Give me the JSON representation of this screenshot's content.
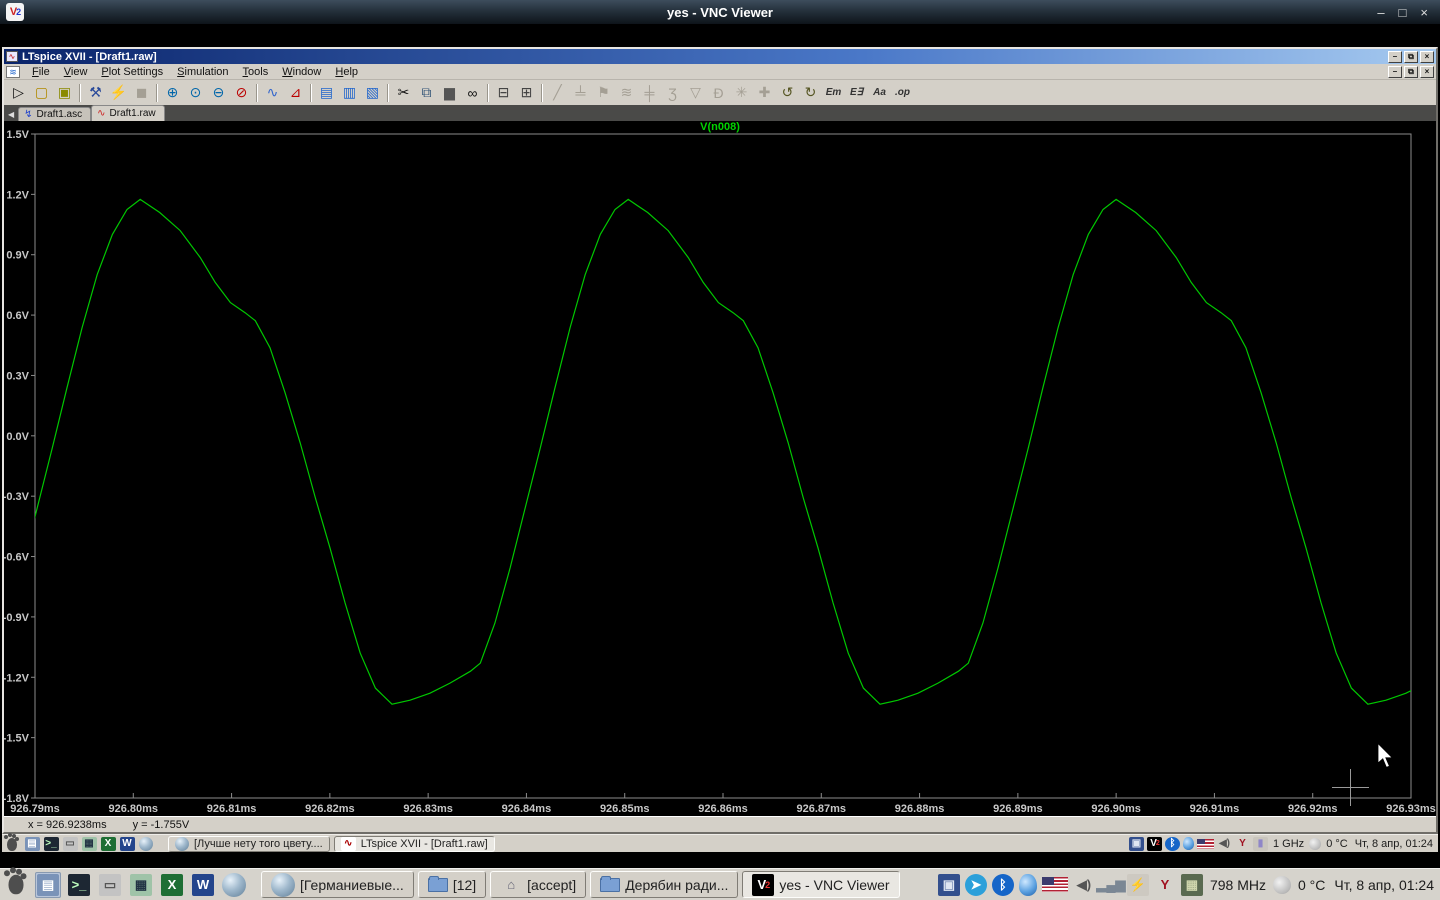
{
  "vnc_titlebar": {
    "logo_text": "V2",
    "title": "yes - VNC Viewer",
    "controls": [
      {
        "name": "vnc-minimize-button",
        "glyph": "–"
      },
      {
        "name": "vnc-maximize-button",
        "glyph": "□"
      },
      {
        "name": "vnc-close-button",
        "glyph": "×"
      }
    ]
  },
  "ltspice": {
    "title": "LTspice XVII - [Draft1.raw]",
    "app_icon_glyph": "∿",
    "menu_icon_glyph": "≋",
    "window_controls": [
      {
        "name": "minimize-button",
        "glyph": "–"
      },
      {
        "name": "restore-button",
        "glyph": "⧉"
      },
      {
        "name": "close-button",
        "glyph": "×"
      }
    ],
    "child_window_controls": [
      {
        "name": "child-minimize-button",
        "glyph": "–"
      },
      {
        "name": "child-restore-button",
        "glyph": "⧉"
      },
      {
        "name": "child-close-button",
        "glyph": "×"
      }
    ],
    "menus": [
      "File",
      "View",
      "Plot Settings",
      "Simulation",
      "Tools",
      "Window",
      "Help"
    ],
    "toolbar": [
      {
        "name": "new-schematic-button",
        "icon": "new-schematic-icon",
        "glyph": "▷",
        "color": "#111"
      },
      {
        "name": "open-button",
        "icon": "open-folder-icon",
        "glyph": "▢",
        "color": "#b08a00"
      },
      {
        "name": "save-button",
        "icon": "save-floppy-icon",
        "glyph": "▣",
        "color": "#8a8a00"
      },
      {
        "sep": true
      },
      {
        "name": "control-panel-button",
        "icon": "hammer-icon",
        "glyph": "⚒",
        "color": "#2a4a9a"
      },
      {
        "name": "run-button",
        "icon": "run-man-icon",
        "glyph": "⚡",
        "color": "#333"
      },
      {
        "name": "halt-button",
        "icon": "halt-hand-icon",
        "glyph": "◼",
        "disabled": true
      },
      {
        "sep": true
      },
      {
        "name": "zoom-in-button",
        "icon": "zoom-in-icon",
        "glyph": "⊕",
        "color": "#06a"
      },
      {
        "name": "zoom-area-button",
        "icon": "magnifier-icon",
        "glyph": "⊙",
        "color": "#06a"
      },
      {
        "name": "zoom-out-button",
        "icon": "zoom-out-icon",
        "glyph": "⊖",
        "color": "#06a"
      },
      {
        "name": "zoom-full-extents-button",
        "icon": "zoom-full-icon",
        "glyph": "⊘",
        "color": "#b00"
      },
      {
        "sep": true
      },
      {
        "name": "autorange-y-button",
        "icon": "waveform-icon",
        "glyph": "∿",
        "color": "#36c"
      },
      {
        "name": "plot-settings-button",
        "icon": "axis-icon",
        "glyph": "⊿",
        "color": "#b00"
      },
      {
        "sep": true
      },
      {
        "name": "tile-horizontal-button",
        "icon": "tile-horizontal-icon",
        "glyph": "▤",
        "color": "#26c"
      },
      {
        "name": "tile-vertical-button",
        "icon": "tile-vertical-icon",
        "glyph": "▥",
        "color": "#26c"
      },
      {
        "name": "cascade-button",
        "icon": "cascade-windows-icon",
        "glyph": "▧",
        "color": "#26c"
      },
      {
        "sep": true
      },
      {
        "name": "cut-button",
        "icon": "scissors-icon",
        "glyph": "✂",
        "color": "#111"
      },
      {
        "name": "copy-button",
        "icon": "copy-icon",
        "glyph": "⧉",
        "color": "#357"
      },
      {
        "name": "paste-button",
        "icon": "clipboard-icon",
        "glyph": "▆",
        "color": "#555"
      },
      {
        "name": "find-button",
        "icon": "binoculars-icon",
        "glyph": "∞",
        "color": "#111"
      },
      {
        "sep": true
      },
      {
        "name": "print-button",
        "icon": "printer-icon",
        "glyph": "⊟",
        "color": "#444"
      },
      {
        "name": "print-preview-button",
        "icon": "print-preview-icon",
        "glyph": "⊞",
        "color": "#444"
      },
      {
        "sep": true
      },
      {
        "name": "wire-button",
        "icon": "wire-icon",
        "glyph": "╱",
        "disabled": true
      },
      {
        "name": "ground-button",
        "icon": "ground-icon",
        "glyph": "╧",
        "disabled": true
      },
      {
        "name": "label-net-button",
        "icon": "net-label-icon",
        "glyph": "⚑",
        "disabled": true
      },
      {
        "name": "resistor-button",
        "icon": "resistor-icon",
        "glyph": "≋",
        "disabled": true
      },
      {
        "name": "capacitor-button",
        "icon": "capacitor-icon",
        "glyph": "╪",
        "disabled": true
      },
      {
        "name": "inductor-button",
        "icon": "inductor-icon",
        "glyph": "Ʒ",
        "disabled": true
      },
      {
        "name": "diode-button",
        "icon": "diode-icon",
        "glyph": "▽",
        "disabled": true
      },
      {
        "name": "gate-button",
        "icon": "d-gate-icon",
        "glyph": "Ð",
        "disabled": true
      },
      {
        "name": "component-button",
        "icon": "component-bug-icon",
        "glyph": "✳",
        "disabled": true
      },
      {
        "name": "drag-button",
        "icon": "hand-icon",
        "glyph": "✚",
        "disabled": true
      },
      {
        "name": "undo-button",
        "icon": "undo-icon",
        "glyph": "↺",
        "color": "#552"
      },
      {
        "name": "redo-button",
        "icon": "redo-icon",
        "glyph": "↻",
        "color": "#552"
      },
      {
        "name": "mirror-button",
        "icon": "mirror-icon",
        "glyph": "Em",
        "text": true,
        "color": "#333"
      },
      {
        "name": "rotate-button",
        "icon": "rotate-icon",
        "glyph": "E∃",
        "text": true,
        "color": "#333"
      },
      {
        "name": "text-button",
        "icon": "text-icon",
        "glyph": "Aa",
        "text": true,
        "color": "#333"
      },
      {
        "name": "spice-directive-button",
        "icon": "spice-directive-icon",
        "glyph": ".op",
        "text": true,
        "color": "#333"
      }
    ],
    "tabbar": {
      "scroll_glyph": "◀",
      "tabs": [
        {
          "label": "Draft1.asc",
          "icon": "schematic-tab-icon",
          "glyph": "↯",
          "glyph_color": "#2244cc",
          "active": false
        },
        {
          "label": "Draft1.raw",
          "icon": "waveform-tab-icon",
          "glyph": "∿",
          "glyph_color": "#cc2222",
          "active": true
        }
      ]
    },
    "statusbar": {
      "x_readout": "x = 926.9238ms",
      "y_readout": "y = -1.755V"
    }
  },
  "chart_data": {
    "type": "line",
    "title": "V(n008)",
    "trace_color": "#00c800",
    "title_color": "#00d400",
    "axis_color": "#8c8c8c",
    "label_color": "#c8c8c8",
    "background": "#000000",
    "x_unit": "ms",
    "y_unit": "V",
    "xlim": [
      926.79,
      926.93
    ],
    "ylim": [
      -1.8,
      1.5
    ],
    "grid": false,
    "xticks": [
      {
        "value": 926.79,
        "label": "926.79ms"
      },
      {
        "value": 926.8,
        "label": "926.80ms"
      },
      {
        "value": 926.81,
        "label": "926.81ms"
      },
      {
        "value": 926.82,
        "label": "926.82ms"
      },
      {
        "value": 926.83,
        "label": "926.83ms"
      },
      {
        "value": 926.84,
        "label": "926.84ms"
      },
      {
        "value": 926.85,
        "label": "926.85ms"
      },
      {
        "value": 926.86,
        "label": "926.86ms"
      },
      {
        "value": 926.87,
        "label": "926.87ms"
      },
      {
        "value": 926.88,
        "label": "926.88ms"
      },
      {
        "value": 926.89,
        "label": "926.89ms"
      },
      {
        "value": 926.9,
        "label": "926.90ms"
      },
      {
        "value": 926.91,
        "label": "926.91ms"
      },
      {
        "value": 926.92,
        "label": "926.92ms"
      },
      {
        "value": 926.93,
        "label": "926.93ms"
      }
    ],
    "yticks": [
      {
        "value": 1.5,
        "label": "1.5V"
      },
      {
        "value": 1.2,
        "label": "1.2V"
      },
      {
        "value": 0.9,
        "label": "0.9V"
      },
      {
        "value": 0.6,
        "label": "0.6V"
      },
      {
        "value": 0.3,
        "label": "0.3V"
      },
      {
        "value": 0.0,
        "label": "0.0V"
      },
      {
        "value": -0.3,
        "label": "-0.3V"
      },
      {
        "value": -0.6,
        "label": "-0.6V"
      },
      {
        "value": -0.9,
        "label": "-0.9V"
      },
      {
        "value": -1.2,
        "label": "-1.2V"
      },
      {
        "value": -1.5,
        "label": "-1.5V"
      },
      {
        "value": -1.8,
        "label": "-1.8V"
      }
    ],
    "signal": {
      "description": "distorted sine, peaks ~1.18V at 926.800/926.850/926.900ms, troughs ~-1.33V",
      "first_peak_ms": 926.8007,
      "period_ms": 0.04965,
      "cycles_visible": 3,
      "cycle_points": [
        [
          0.0,
          1.175
        ],
        [
          0.04,
          1.11
        ],
        [
          0.082,
          1.02
        ],
        [
          0.123,
          0.886
        ],
        [
          0.154,
          0.762
        ],
        [
          0.185,
          0.662
        ],
        [
          0.215,
          0.612
        ],
        [
          0.236,
          0.572
        ],
        [
          0.266,
          0.438
        ],
        [
          0.297,
          0.214
        ],
        [
          0.328,
          -0.035
        ],
        [
          0.359,
          -0.309
        ],
        [
          0.389,
          -0.557
        ],
        [
          0.42,
          -0.831
        ],
        [
          0.451,
          -1.08
        ],
        [
          0.482,
          -1.254
        ],
        [
          0.516,
          -1.334
        ],
        [
          0.553,
          -1.314
        ],
        [
          0.594,
          -1.279
        ],
        [
          0.635,
          -1.229
        ],
        [
          0.677,
          -1.17
        ],
        [
          0.697,
          -1.13
        ],
        [
          0.727,
          -0.931
        ],
        [
          0.758,
          -0.657
        ],
        [
          0.789,
          -0.358
        ],
        [
          0.82,
          -0.06
        ],
        [
          0.85,
          0.239
        ],
        [
          0.881,
          0.538
        ],
        [
          0.912,
          0.801
        ],
        [
          0.943,
          1.001
        ],
        [
          0.973,
          1.125
        ]
      ]
    }
  },
  "inner_taskbar": {
    "launchers": [
      {
        "name": "menu-foot-icon",
        "kind": "foot"
      },
      {
        "name": "file-manager-launcher",
        "kind": "glyph",
        "glyph": "▤",
        "fg": "#fff",
        "bg": "#7a93b8"
      },
      {
        "name": "terminal-launcher",
        "kind": "glyph",
        "glyph": ">_",
        "fg": "#bfffbf",
        "bg": "#1d2733"
      },
      {
        "name": "floppy-drive-launcher",
        "kind": "glyph",
        "glyph": "▭",
        "fg": "#555",
        "bg": "#c3c3c3"
      },
      {
        "name": "calculator-launcher",
        "kind": "glyph",
        "glyph": "▦",
        "fg": "#234",
        "bg": "#9fc3a8"
      },
      {
        "name": "excel-launcher",
        "kind": "glyph",
        "glyph": "X",
        "fg": "#fff",
        "bg": "#1e6e34"
      },
      {
        "name": "word-launcher",
        "kind": "glyph",
        "glyph": "W",
        "fg": "#fff",
        "bg": "#24458c"
      },
      {
        "name": "globe-launcher",
        "kind": "globe"
      }
    ],
    "windows": [
      {
        "name": "taskbar-window-browser",
        "icon": {
          "kind": "globe"
        },
        "label": "[Лучше нету того цвету....",
        "active": false
      },
      {
        "name": "taskbar-window-ltspice",
        "icon": {
          "kind": "glyph",
          "glyph": "∿",
          "fg": "#a00",
          "bg": "#fff"
        },
        "label": "LTspice XVII - [Draft1.raw]",
        "active": true
      }
    ],
    "tray": [
      {
        "name": "save-tray-icon",
        "kind": "glyph",
        "glyph": "▣",
        "fg": "#dfe6f2",
        "bg": "#334f8d"
      },
      {
        "name": "vnc-tray-icon",
        "kind": "vnc",
        "text": "V2"
      },
      {
        "name": "bluetooth-tray-icon",
        "kind": "glyph",
        "glyph": "ᛒ",
        "fg": "#fff",
        "bg": "#1565c8",
        "round": true
      },
      {
        "name": "waterdrop-tray-icon",
        "kind": "drop"
      },
      {
        "name": "us-flag-tray-icon",
        "kind": "flag"
      },
      {
        "name": "volume-tray-icon",
        "kind": "glyph",
        "glyph": "◀)",
        "fg": "#555",
        "bg": "transparent"
      },
      {
        "name": "wine-tray-icon",
        "kind": "glyph",
        "glyph": "Y",
        "fg": "#a01020",
        "bg": "transparent"
      },
      {
        "name": "battery-tray-icon",
        "kind": "glyph",
        "glyph": "▮",
        "fg": "#8f86c8",
        "bg": "#c9c5bd"
      },
      {
        "name": "cpu-frequency-text",
        "kind": "text",
        "text": "1  GHz"
      },
      {
        "name": "moon-tray-icon",
        "kind": "moon"
      },
      {
        "name": "temperature-text",
        "kind": "text",
        "text": "0 °C"
      },
      {
        "name": "clock-text",
        "kind": "text",
        "text": "Чт,  8 апр, 01:24"
      }
    ]
  },
  "outer_taskbar": {
    "launchers": [
      {
        "name": "host-menu-foot-icon",
        "kind": "foot"
      },
      {
        "name": "host-file-manager-launcher",
        "kind": "glyph",
        "glyph": "▤",
        "fg": "#fff",
        "bg": "#7a93b8",
        "pressed": true
      },
      {
        "name": "host-terminal-launcher",
        "kind": "glyph",
        "glyph": ">_",
        "fg": "#bfffbf",
        "bg": "#1d2733"
      },
      {
        "name": "host-floppy-drive-launcher",
        "kind": "glyph",
        "glyph": "▭",
        "fg": "#555",
        "bg": "#c3c3c3"
      },
      {
        "name": "host-calculator-launcher",
        "kind": "glyph",
        "glyph": "▦",
        "fg": "#234",
        "bg": "#9fc3a8"
      },
      {
        "name": "host-excel-launcher",
        "kind": "glyph",
        "glyph": "X",
        "fg": "#fff",
        "bg": "#1e6e34"
      },
      {
        "name": "host-word-launcher",
        "kind": "glyph",
        "glyph": "W",
        "fg": "#fff",
        "bg": "#24458c"
      },
      {
        "name": "host-globe-launcher",
        "kind": "globe"
      }
    ],
    "windows": [
      {
        "name": "host-window-germanium",
        "icon": {
          "kind": "globe"
        },
        "label": "[Германиевые...",
        "active": false
      },
      {
        "name": "host-window-12",
        "icon": {
          "kind": "folder"
        },
        "label": "[12]",
        "active": false
      },
      {
        "name": "host-window-accept",
        "icon": {
          "kind": "glyph",
          "glyph": "⌂",
          "fg": "#667",
          "bg": "transparent"
        },
        "label": "[accept]",
        "active": false
      },
      {
        "name": "host-window-deryabin",
        "icon": {
          "kind": "folder"
        },
        "label": "Дерябин ради...",
        "active": false
      },
      {
        "name": "host-window-vnc",
        "icon": {
          "kind": "vnc",
          "text": "V2"
        },
        "label": "yes - VNC Viewer",
        "active": true
      }
    ],
    "tray": [
      {
        "name": "host-save-tray-icon",
        "kind": "glyph",
        "glyph": "▣",
        "fg": "#dfe6f2",
        "bg": "#334f8d"
      },
      {
        "name": "telegram-tray-icon",
        "kind": "glyph",
        "glyph": "➤",
        "fg": "#fff",
        "bg": "#2ca0da",
        "round": true
      },
      {
        "name": "host-bluetooth-tray-icon",
        "kind": "glyph",
        "glyph": "ᛒ",
        "fg": "#fff",
        "bg": "#1565c8",
        "round": true
      },
      {
        "name": "host-waterdrop-tray-icon",
        "kind": "drop"
      },
      {
        "name": "host-us-flag-tray-icon",
        "kind": "flag"
      },
      {
        "name": "host-volume-tray-icon",
        "kind": "glyph",
        "glyph": "◀)",
        "fg": "#555",
        "bg": "transparent"
      },
      {
        "name": "signal-bars-tray-icon",
        "kind": "glyph",
        "glyph": "▂▄▆",
        "fg": "#7b8794",
        "bg": "transparent"
      },
      {
        "name": "charger-tray-icon",
        "kind": "glyph",
        "glyph": "⚡",
        "fg": "#c9a227",
        "bg": "#cdc9c1"
      },
      {
        "name": "host-wine-tray-icon",
        "kind": "glyph",
        "glyph": "Y",
        "fg": "#a01020",
        "bg": "transparent"
      },
      {
        "name": "cpu-chip-tray-icon",
        "kind": "glyph",
        "glyph": "▦",
        "fg": "#cfd6ad",
        "bg": "#5a6a50"
      },
      {
        "name": "host-cpu-frequency-text",
        "kind": "text",
        "text": "798 MHz"
      },
      {
        "name": "host-moon-tray-icon",
        "kind": "moon"
      },
      {
        "name": "host-temperature-text",
        "kind": "text",
        "text": "0 °C"
      },
      {
        "name": "host-clock-text",
        "kind": "text",
        "text": "Чт,  8 апр, 01:24"
      }
    ]
  }
}
